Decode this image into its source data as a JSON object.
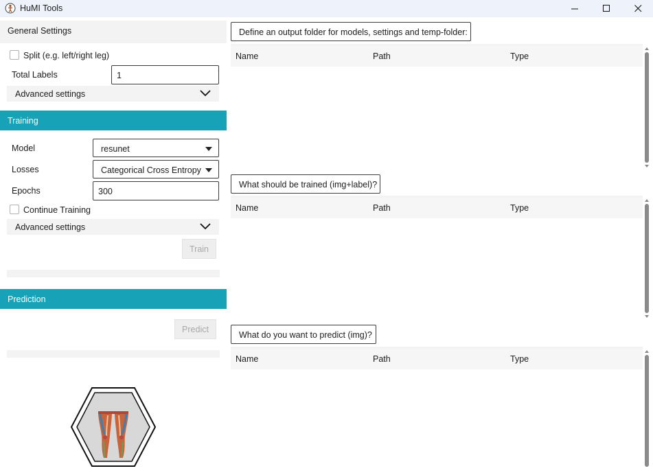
{
  "window": {
    "title": "HuMI Tools",
    "minimize_icon": "minimize-icon",
    "maximize_icon": "maximize-icon",
    "close_icon": "close-icon"
  },
  "general_settings": {
    "header": "General Settings",
    "split_label": "Split (e.g. left/right leg)",
    "split_checked": false,
    "total_labels_label": "Total Labels",
    "total_labels_value": "1",
    "advanced_label": "Advanced settings"
  },
  "training": {
    "header": "Training",
    "model_label": "Model",
    "model_value": "resunet",
    "losses_label": "Losses",
    "losses_value": "Categorical Cross Entropy",
    "epochs_label": "Epochs",
    "epochs_value": "300",
    "continue_label": "Continue Training",
    "continue_checked": false,
    "advanced_label": "Advanced settings",
    "train_button": "Train"
  },
  "prediction": {
    "header": "Prediction",
    "predict_button": "Predict"
  },
  "output_folder": {
    "button": "Define an output folder for models, settings and temp-folder:",
    "columns": [
      "Name",
      "Path",
      "Type"
    ]
  },
  "train_data": {
    "button": "What should be trained (img+label)?",
    "columns": [
      "Name",
      "Path",
      "Type"
    ]
  },
  "predict_data": {
    "button": "What do you want to predict (img)?",
    "columns": [
      "Name",
      "Path",
      "Type"
    ]
  },
  "colors": {
    "accent": "#17a2b8",
    "titlebar": "#eef2fa",
    "panel": "#f3f3f3"
  }
}
